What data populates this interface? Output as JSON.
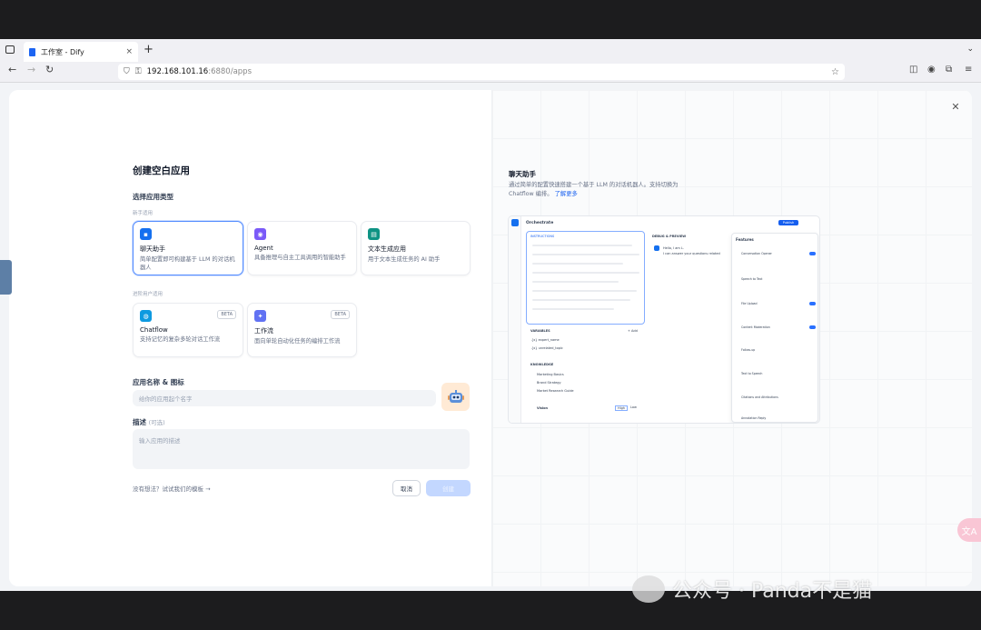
{
  "browser": {
    "tab_title": "工作室 - Dify",
    "tab_close": "×",
    "new_tab": "+",
    "url_host": "192.168.101.16",
    "url_path": ":6880/apps"
  },
  "modal": {
    "title": "创建空白应用",
    "app_type_label": "选择应用类型",
    "beginner_label": "新手适用",
    "advanced_label": "进阶用户适用",
    "cards_beginner": [
      {
        "title": "聊天助手",
        "desc": "简单配置即可构建基于 LLM 的对话机器人",
        "color": "#1570ef",
        "icon": "chat-bubble-icon"
      },
      {
        "title": "Agent",
        "desc": "具备推理与自主工具调用的智能助手",
        "color": "#7a5af8",
        "icon": "robot-icon"
      },
      {
        "title": "文本生成应用",
        "desc": "用于文本生成任务的 AI 助手",
        "color": "#0e9384",
        "icon": "text-doc-icon"
      }
    ],
    "cards_advanced": [
      {
        "title": "Chatflow",
        "desc": "支持记忆的复杂多轮对话工作流",
        "badge": "BETA",
        "color": "#0e9ae0",
        "icon": "chatflow-icon"
      },
      {
        "title": "工作流",
        "desc": "面向单轮自动化任务的编排工作流",
        "badge": "BETA",
        "color": "#6172f3",
        "icon": "workflow-icon"
      }
    ],
    "name_label": "应用名称 & 图标",
    "name_placeholder": "给你的应用起个名字",
    "desc_label": "描述",
    "desc_optional": "(可选)",
    "desc_placeholder": "输入应用的描述",
    "template_tip": "没有想法？试试我们的模板 →",
    "cancel_label": "取消",
    "create_label": "创建"
  },
  "preview": {
    "title": "聊天助手",
    "desc_line1": "通过简单的配置快速搭建一个基于 LLM 的对话机器人。支持切换为",
    "desc_line2": "Chatflow 编排。",
    "learn_more": "了解更多",
    "orchestrate": "Orchestrate",
    "instructions": "INSTRUCTIONS",
    "debug": "DEBUG & PREVIEW",
    "variables": "VARIABLES",
    "knowledge": "KNOWLEDGE",
    "vision": "Vision",
    "features_title": "Features",
    "hello": "Hello, I am L.",
    "hello2": "I can answer your questions related",
    "var1": "{x} expert_name",
    "var2": "{x} unrelated_topic",
    "k1": "Marketing Basics",
    "k2": "Brand Strategy",
    "k3": "Market Research Guide",
    "features": [
      "Conversation Opener",
      "Speech to Text",
      "File Upload",
      "Content Moderation",
      "Follow-up",
      "Text to Speech",
      "Citations and Attributions",
      "Annotation Reply"
    ],
    "high": "High",
    "low": "Low",
    "add": "+ Add",
    "publish": "Publish"
  },
  "watermark": "公众号 · Panda不是猫",
  "translate_icon": "文A"
}
